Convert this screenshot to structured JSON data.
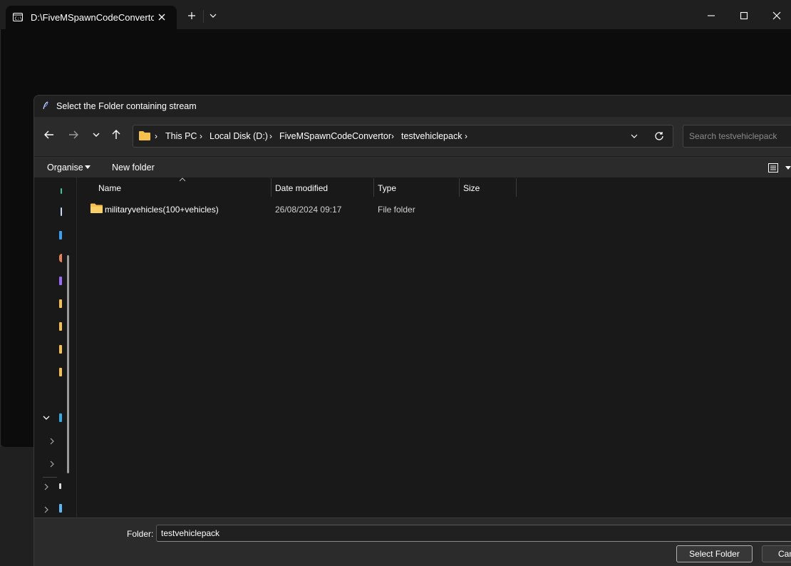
{
  "terminal": {
    "tab_title": "D:\\FiveMSpawnCodeConvertc",
    "icons": {
      "tab": "terminal-icon",
      "close": "close-icon",
      "new_tab": "plus-icon",
      "dropdown": "chevron-down-icon",
      "minimize": "minimize-icon",
      "maximize": "maximize-icon",
      "window_close": "close-icon"
    }
  },
  "dialog": {
    "title": "Select the Folder containing stream",
    "breadcrumb": [
      "This PC",
      "Local Disk (D:)",
      "FiveMSpawnCodeConvertor",
      "testvehiclepack"
    ],
    "search_placeholder": "Search testvehiclepack",
    "commands": {
      "organise": "Organise",
      "new_folder": "New folder"
    },
    "columns": {
      "name": "Name",
      "date": "Date modified",
      "type": "Type",
      "size": "Size"
    },
    "files": [
      {
        "name": "militaryvehicles(100+vehicles)",
        "date": "26/08/2024 09:17",
        "type": "File folder",
        "size": ""
      }
    ],
    "footer": {
      "folder_label": "Folder:",
      "folder_value": "testvehiclepack",
      "select_button": "Select Folder",
      "cancel_button": "Cancel"
    }
  },
  "colors": {
    "folder_yellow": "#f4c04e",
    "dark_bg": "#191919",
    "bar_bg": "#2b2b2b"
  }
}
